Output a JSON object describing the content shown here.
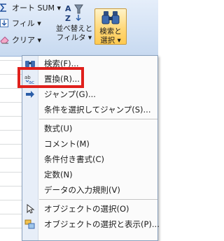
{
  "ribbon": {
    "autosum_label": "オート SUM ▾",
    "fill_label": "フィル ▾",
    "clear_label": "クリア ▾",
    "sort_filter_label_1": "並べ替えと",
    "sort_filter_label_2": "フィルタ ▾",
    "find_select_label_1": "検索と",
    "find_select_label_2": "選択 ▾"
  },
  "menu": {
    "items": [
      {
        "label": "検索(F)...",
        "icon": "binoculars-icon"
      },
      {
        "label": "置換(R)...",
        "icon": "replace-icon"
      },
      {
        "label": "ジャンプ(G)...",
        "icon": "arrow-right-icon"
      },
      {
        "label": "条件を選択してジャンプ(S)...",
        "icon": ""
      },
      {
        "label": "数式(U)",
        "icon": ""
      },
      {
        "label": "コメント(M)",
        "icon": ""
      },
      {
        "label": "条件付き書式(C)",
        "icon": ""
      },
      {
        "label": "定数(N)",
        "icon": ""
      },
      {
        "label": "データの入力規則(V)",
        "icon": ""
      },
      {
        "label": "オブジェクトの選択(O)",
        "icon": "select-objects-icon"
      },
      {
        "label": "オブジェクトの選択と表示(P)...",
        "icon": "selection-pane-icon"
      }
    ]
  },
  "colors": {
    "highlight": "#e0201c",
    "ribbon_bg": "#d5e3f5",
    "active_button": "#ffd87a",
    "menu_gutter": "#e7eef8"
  }
}
